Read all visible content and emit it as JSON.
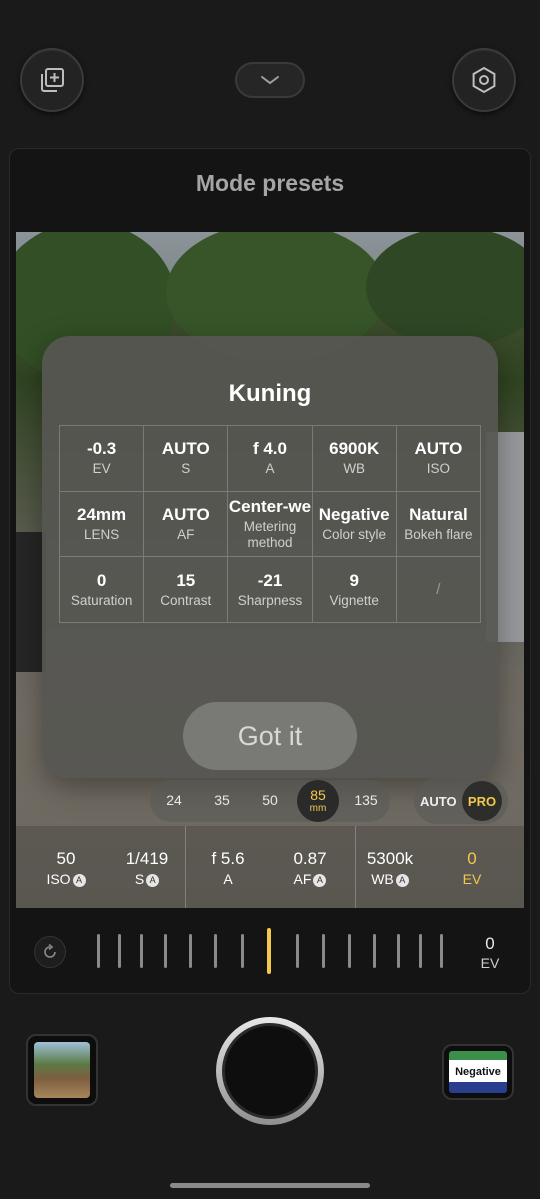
{
  "header": {
    "title": "Mode presets"
  },
  "icons": {
    "add_preset": "add-layer-icon",
    "collapse": "chevron-down-icon",
    "settings": "hexagon-settings-icon",
    "reset": "reset-icon"
  },
  "preset_modal": {
    "title": "Kuning",
    "rows": [
      [
        {
          "value": "-0.3",
          "label": "EV"
        },
        {
          "value": "AUTO",
          "label": "S"
        },
        {
          "value": "f 4.0",
          "label": "A"
        },
        {
          "value": "6900K",
          "label": "WB"
        },
        {
          "value": "AUTO",
          "label": "ISO"
        }
      ],
      [
        {
          "value": "24mm",
          "label": "LENS"
        },
        {
          "value": "AUTO",
          "label": "AF"
        },
        {
          "value": "Center-we",
          "label": "Metering method"
        },
        {
          "value": "Negative",
          "label": "Color style"
        },
        {
          "value": "Natural",
          "label": "Bokeh flare"
        }
      ],
      [
        {
          "value": "0",
          "label": "Saturation"
        },
        {
          "value": "15",
          "label": "Contrast"
        },
        {
          "value": "-21",
          "label": "Sharpness"
        },
        {
          "value": "9",
          "label": "Vignette"
        },
        {
          "value": "",
          "label": "/"
        }
      ]
    ],
    "confirm_label": "Got it"
  },
  "focal_lengths": {
    "options": [
      "24",
      "35",
      "50",
      "85",
      "135"
    ],
    "selected": "85",
    "unit": "mm"
  },
  "mode_toggle": {
    "auto_label": "AUTO",
    "pro_label": "PRO"
  },
  "params": [
    {
      "value": "50",
      "label": "ISO",
      "auto": "A"
    },
    {
      "value": "1/419",
      "label": "S",
      "auto": "A"
    },
    {
      "value": "f 5.6",
      "label": "A",
      "auto": ""
    },
    {
      "value": "0.87",
      "label": "AF",
      "auto": "A"
    },
    {
      "value": "5300k",
      "label": "WB",
      "auto": "A"
    },
    {
      "value": "0",
      "label": "EV",
      "auto": ""
    }
  ],
  "ev_dial": {
    "value": "0",
    "label": "EV"
  },
  "film_style": {
    "label": "Negative"
  },
  "colors": {
    "accent": "#f2c94c",
    "background": "#1a1a1a",
    "modal": "#565652"
  }
}
